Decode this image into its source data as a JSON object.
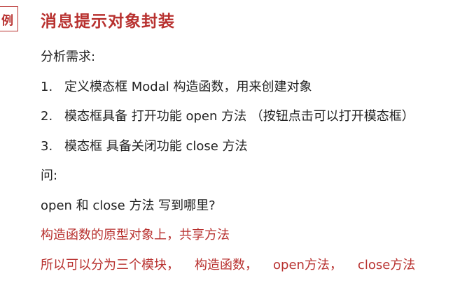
{
  "header": {
    "tag": "例",
    "title": "消息提示对象封装"
  },
  "requirements": {
    "heading": "分析需求:",
    "items": [
      {
        "number": "1.",
        "text": "定义模态框 Modal 构造函数，用来创建对象"
      },
      {
        "number": "2.",
        "text": "模态框具备 打开功能 open 方法 （按钮点击可以打开模态框）"
      },
      {
        "number": "3.",
        "text": "模态框 具备关闭功能  close 方法"
      }
    ]
  },
  "question": {
    "label": "问:",
    "text": "open 和 close 方法 写到哪里?"
  },
  "answer": {
    "line1": "构造函数的原型对象上，共享方法",
    "parts": [
      "所以可以分为三个模块，",
      "构造函数，",
      "open方法，",
      "close方法"
    ]
  },
  "colors": {
    "accent": "#b8312f",
    "text": "#222222"
  }
}
